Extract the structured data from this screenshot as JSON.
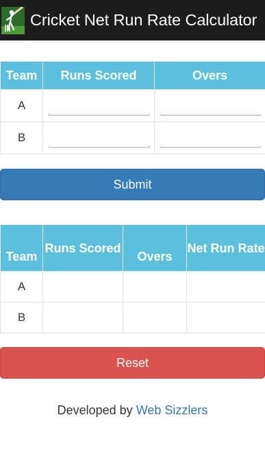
{
  "app": {
    "title": "Cricket Net Run Rate Calculator",
    "logo_icon": "cricket-batsman-icon"
  },
  "input_table": {
    "headers": [
      "Team",
      "Runs Scored",
      "Overs"
    ],
    "rows": [
      {
        "team": "A",
        "runs_scored": "",
        "overs": ""
      },
      {
        "team": "B",
        "runs_scored": "",
        "overs": ""
      }
    ]
  },
  "buttons": {
    "submit_label": "Submit",
    "reset_label": "Reset"
  },
  "result_table": {
    "headers": [
      "Team",
      "Runs Scored",
      "Overs",
      "Net Run Rate"
    ],
    "rows": [
      {
        "team": "A",
        "runs_scored": "",
        "overs": "",
        "net_run_rate": ""
      },
      {
        "team": "B",
        "runs_scored": "",
        "overs": "",
        "net_run_rate": ""
      }
    ]
  },
  "footer": {
    "prefix": "Developed by",
    "link_text": "Web Sizzlers"
  },
  "colors": {
    "header_cell": "#5bc0de",
    "submit": "#337ab7",
    "reset": "#d9534f",
    "app_bar": "#1c1c1c"
  }
}
